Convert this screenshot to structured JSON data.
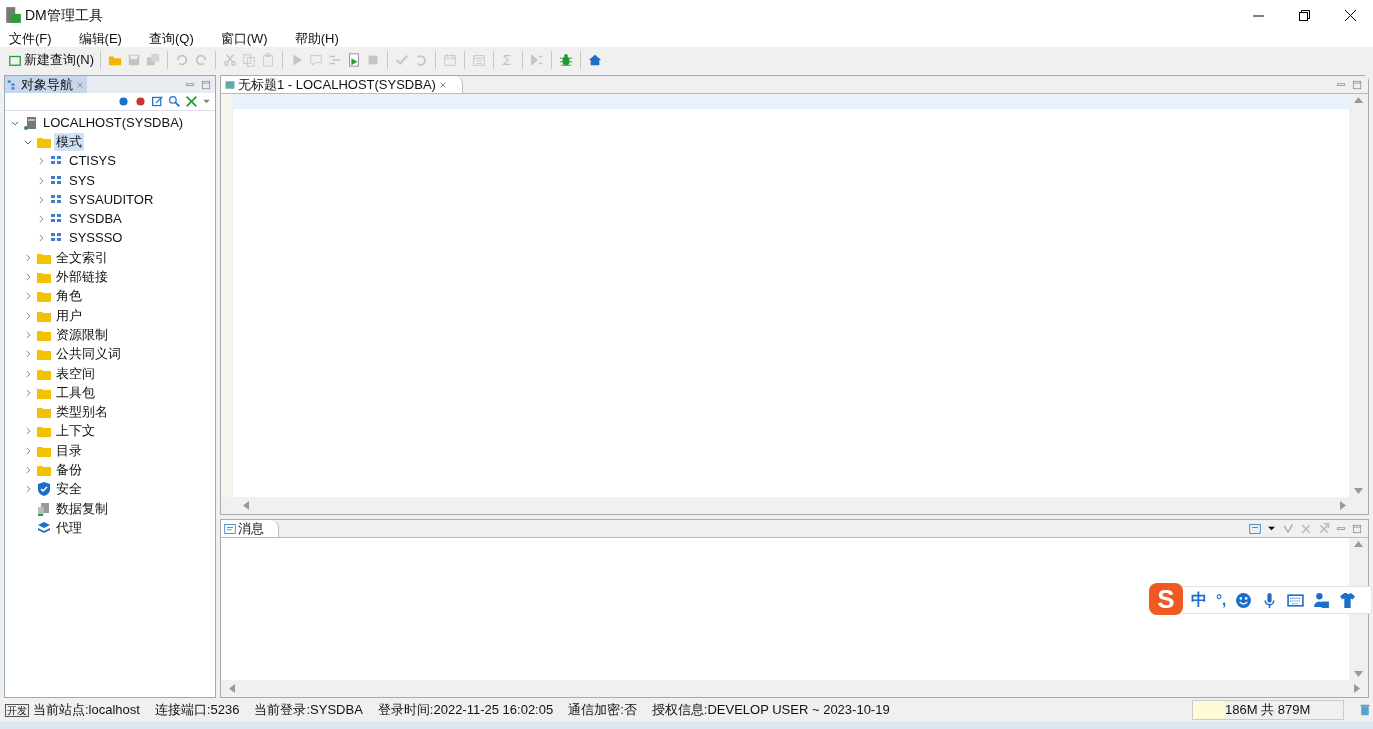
{
  "window": {
    "title": "DM管理工具"
  },
  "menu": [
    "文件(F)",
    "编辑(E)",
    "查询(Q)",
    "窗口(W)",
    "帮助(H)"
  ],
  "toolbar": [
    {
      "kind": "text",
      "label": "新建查询(N)",
      "disabled": false
    },
    {
      "kind": "sep"
    },
    {
      "kind": "icon",
      "disabled": false
    },
    {
      "kind": "icon",
      "disabled": true
    },
    {
      "kind": "icon",
      "disabled": true
    },
    {
      "kind": "sep"
    },
    {
      "kind": "icon",
      "disabled": true
    },
    {
      "kind": "icon",
      "disabled": true
    },
    {
      "kind": "sep"
    },
    {
      "kind": "icon",
      "disabled": true
    },
    {
      "kind": "icon",
      "disabled": true
    },
    {
      "kind": "icon",
      "disabled": true
    },
    {
      "kind": "sep"
    },
    {
      "kind": "icon",
      "disabled": true
    },
    {
      "kind": "icon",
      "disabled": true
    },
    {
      "kind": "icon",
      "disabled": true
    },
    {
      "kind": "icon",
      "disabled": false
    },
    {
      "kind": "icon",
      "disabled": true
    },
    {
      "kind": "sep"
    },
    {
      "kind": "icon",
      "disabled": true
    },
    {
      "kind": "icon",
      "disabled": true
    },
    {
      "kind": "sep"
    },
    {
      "kind": "icon",
      "disabled": true
    },
    {
      "kind": "sep"
    },
    {
      "kind": "icon",
      "disabled": true
    },
    {
      "kind": "sep"
    },
    {
      "kind": "icon",
      "disabled": true
    },
    {
      "kind": "sep"
    },
    {
      "kind": "icon",
      "disabled": true
    },
    {
      "kind": "sep"
    },
    {
      "kind": "icon",
      "disabled": false
    },
    {
      "kind": "sep"
    },
    {
      "kind": "icon",
      "disabled": false
    }
  ],
  "navigator": {
    "tab": "对象导航",
    "tree": [
      {
        "label": "LOCALHOST(SYSDBA)",
        "kind": "server",
        "expanded": true,
        "selected": false,
        "children": [
          {
            "label": "模式",
            "kind": "folder",
            "expanded": true,
            "selected": true,
            "children": [
              {
                "label": "CTISYS",
                "kind": "schema",
                "expanded": false,
                "selected": false
              },
              {
                "label": "SYS",
                "kind": "schema",
                "expanded": false,
                "selected": false
              },
              {
                "label": "SYSAUDITOR",
                "kind": "schema",
                "expanded": false,
                "selected": false
              },
              {
                "label": "SYSDBA",
                "kind": "schema",
                "expanded": false,
                "selected": false
              },
              {
                "label": "SYSSSO",
                "kind": "schema",
                "expanded": false,
                "selected": false
              }
            ]
          },
          {
            "label": "全文索引",
            "kind": "folder",
            "expanded": false,
            "selected": false
          },
          {
            "label": "外部链接",
            "kind": "folder",
            "expanded": false,
            "selected": false
          },
          {
            "label": "角色",
            "kind": "folder",
            "expanded": false,
            "selected": false
          },
          {
            "label": "用户",
            "kind": "folder",
            "expanded": false,
            "selected": false
          },
          {
            "label": "资源限制",
            "kind": "folder",
            "expanded": false,
            "selected": false
          },
          {
            "label": "公共同义词",
            "kind": "folder",
            "expanded": false,
            "selected": false
          },
          {
            "label": "表空间",
            "kind": "folder",
            "expanded": false,
            "selected": false
          },
          {
            "label": "工具包",
            "kind": "folder",
            "expanded": false,
            "selected": false
          },
          {
            "label": "类型别名",
            "kind": "folder",
            "selected": false
          },
          {
            "label": "上下文",
            "kind": "folder",
            "expanded": false,
            "selected": false
          },
          {
            "label": "目录",
            "kind": "folder",
            "expanded": false,
            "selected": false
          },
          {
            "label": "备份",
            "kind": "folder",
            "expanded": false,
            "selected": false
          },
          {
            "label": "安全",
            "kind": "shield",
            "expanded": false,
            "selected": false
          },
          {
            "label": "数据复制",
            "kind": "replication",
            "selected": false
          },
          {
            "label": "代理",
            "kind": "layers",
            "selected": false
          }
        ]
      }
    ]
  },
  "editor": {
    "tab": "无标题1 - LOCALHOST(SYSDBA)"
  },
  "messages": {
    "tab": "消息"
  },
  "ime_bar": {
    "logo": "S",
    "mode": "中",
    "punctuation": "°,"
  },
  "status_bar": {
    "badge": "开发",
    "items": [
      "当前站点:localhost",
      "连接端口:5236",
      "当前登录:SYSDBA",
      "登录时间:2022-11-25 16:02:05",
      "通信加密:否",
      "授权信息:DEVELOP USER ~ 2023-10-19"
    ],
    "memory": {
      "label": "186M 共 879M",
      "level": 0.21
    }
  }
}
